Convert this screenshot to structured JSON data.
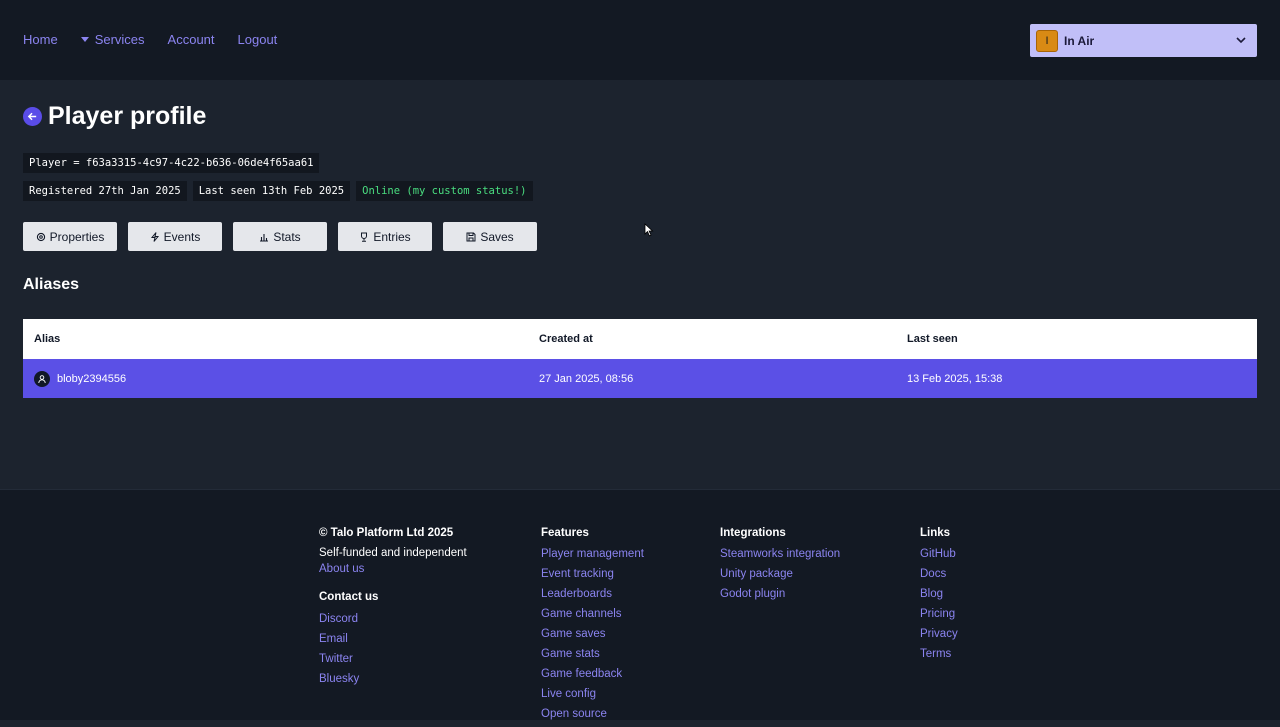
{
  "nav": {
    "links": [
      "Home",
      "Services",
      "Account",
      "Logout"
    ],
    "game": {
      "initial": "I",
      "name": "In Air"
    }
  },
  "header": {
    "title": "Player profile",
    "player_id": "Player = f63a3315-4c97-4c22-b636-06de4f65aa61",
    "registered": "Registered 27th Jan 2025",
    "last_seen": "Last seen 13th Feb 2025",
    "status": "Online (my custom status!)"
  },
  "tabs": [
    "Properties",
    "Events",
    "Stats",
    "Entries",
    "Saves"
  ],
  "aliases": {
    "title": "Aliases",
    "columns": [
      "Alias",
      "Created at",
      "Last seen"
    ],
    "rows": [
      {
        "alias": "bloby2394556",
        "created": "27 Jan 2025, 08:56",
        "last_seen": "13 Feb 2025, 15:38"
      }
    ]
  },
  "footer": {
    "company": "© Talo Platform Ltd 2025",
    "tagline": "Self-funded and independent",
    "about": "About us",
    "contact_title": "Contact us",
    "contact": [
      "Discord",
      "Email",
      "Twitter",
      "Bluesky"
    ],
    "features_title": "Features",
    "features": [
      "Player management",
      "Event tracking",
      "Leaderboards",
      "Game channels",
      "Game saves",
      "Game stats",
      "Game feedback",
      "Live config",
      "Open source"
    ],
    "integrations_title": "Integrations",
    "integrations": [
      "Steamworks integration",
      "Unity package",
      "Godot plugin"
    ],
    "links_title": "Links",
    "links": [
      "GitHub",
      "Docs",
      "Blog",
      "Pricing",
      "Privacy",
      "Terms"
    ]
  },
  "colors": {
    "background": "#1c232e",
    "nav": "#131923",
    "accent": "#5b50e6",
    "link": "#8b84f0",
    "online": "#4ade80"
  }
}
